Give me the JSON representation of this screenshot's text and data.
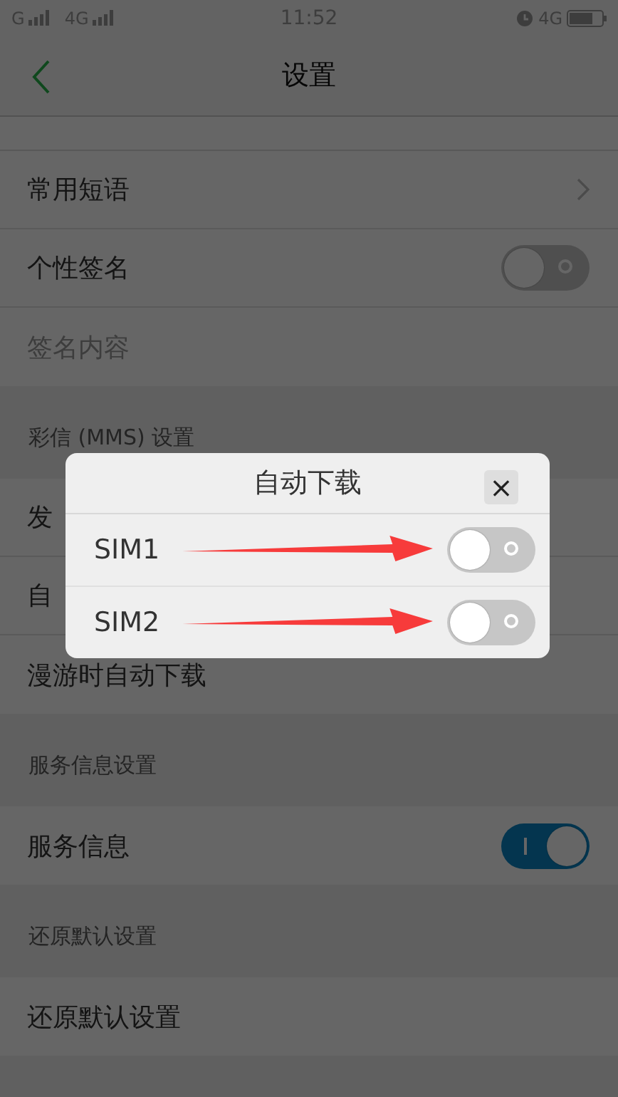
{
  "status_bar": {
    "network_1": "G",
    "network_2": "4G",
    "time": "11:52",
    "network_3": "4G"
  },
  "header": {
    "title": "设置"
  },
  "sections": [
    {
      "items": [
        {
          "label": "常用短语",
          "kind": "link",
          "disabled": false
        },
        {
          "label": "个性签名",
          "kind": "toggle",
          "on": false,
          "disabled": false
        },
        {
          "label": "签名内容",
          "kind": "plain",
          "disabled": true
        }
      ]
    },
    {
      "title": "彩信 (MMS) 设置",
      "items": [
        {
          "label": "发",
          "kind": "plain",
          "disabled": false
        },
        {
          "label": "自",
          "kind": "plain",
          "disabled": false
        },
        {
          "label": "漫游时自动下载",
          "kind": "plain",
          "disabled": false
        }
      ]
    },
    {
      "title": "服务信息设置",
      "items": [
        {
          "label": "服务信息",
          "kind": "toggle",
          "on": true,
          "disabled": false
        }
      ]
    },
    {
      "title": "还原默认设置",
      "items": [
        {
          "label": "还原默认设置",
          "kind": "plain",
          "disabled": false
        }
      ]
    }
  ],
  "dialog": {
    "title": "自动下载",
    "close": "×",
    "rows": [
      {
        "label": "SIM1",
        "on": false
      },
      {
        "label": "SIM2",
        "on": false
      }
    ]
  }
}
